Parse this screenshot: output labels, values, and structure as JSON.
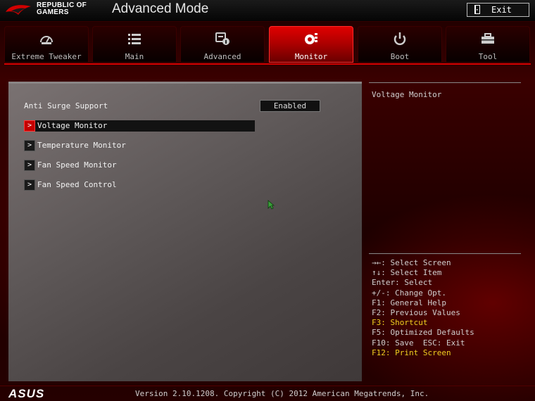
{
  "header": {
    "brand_line1": "REPUBLIC OF",
    "brand_line2": "GAMERS",
    "mode_title": "Advanced Mode",
    "exit_label": "Exit"
  },
  "tabs": [
    {
      "label": "Extreme Tweaker",
      "icon": "speedometer-icon",
      "active": false
    },
    {
      "label": "Main",
      "icon": "list-icon",
      "active": false
    },
    {
      "label": "Advanced",
      "icon": "advanced-settings-icon",
      "active": false
    },
    {
      "label": "Monitor",
      "icon": "monitor-gauge-icon",
      "active": true
    },
    {
      "label": "Boot",
      "icon": "power-icon",
      "active": false
    },
    {
      "label": "Tool",
      "icon": "toolbox-icon",
      "active": false
    }
  ],
  "main": {
    "setting": {
      "label": "Anti Surge Support",
      "value": "Enabled"
    },
    "submenus": [
      {
        "label": "Voltage Monitor",
        "selected": true
      },
      {
        "label": "Temperature Monitor",
        "selected": false
      },
      {
        "label": "Fan Speed Monitor",
        "selected": false
      },
      {
        "label": "Fan Speed Control",
        "selected": false
      }
    ],
    "arrow_glyph": ">"
  },
  "help": {
    "description": "Voltage Monitor",
    "keys": [
      {
        "text": "→←: Select Screen",
        "highlight": false
      },
      {
        "text": "↑↓: Select Item",
        "highlight": false
      },
      {
        "text": "Enter: Select",
        "highlight": false
      },
      {
        "text": "+/-: Change Opt.",
        "highlight": false
      },
      {
        "text": "F1: General Help",
        "highlight": false
      },
      {
        "text": "F2: Previous Values",
        "highlight": false
      },
      {
        "text": "F3: Shortcut",
        "highlight": true
      },
      {
        "text": "F5: Optimized Defaults",
        "highlight": false
      },
      {
        "text": "F10: Save  ESC: Exit",
        "highlight": false
      },
      {
        "text": "F12: Print Screen",
        "highlight": true
      }
    ]
  },
  "footer": {
    "asus_logo": "ASUS",
    "version": "Version 2.10.1208. Copyright (C) 2012 American Megatrends, Inc."
  },
  "colors": {
    "accent_red": "#d40000",
    "highlight_yellow": "#f0d020"
  }
}
